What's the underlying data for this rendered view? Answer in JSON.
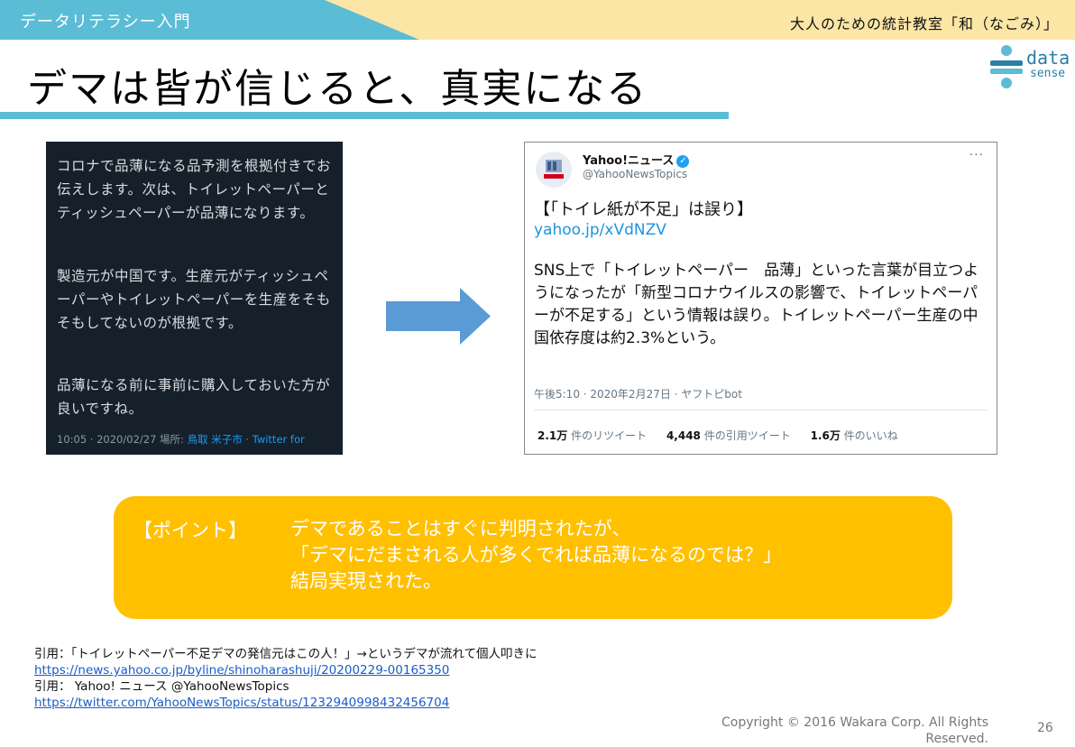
{
  "header": {
    "left_label": "データリテラシー入門",
    "right_label": "大人のための統計教室「和（なごみ）」"
  },
  "title": "デマは皆が信じると、真実になる",
  "logo": {
    "line1": "data",
    "line2": "sense",
    "accent_color": "#2a7fa8"
  },
  "colors": {
    "header_blue": "#5bbcd6",
    "header_yellow": "#fbe6a6",
    "point_box": "#ffc000",
    "arrow": "#5b9bd5"
  },
  "dark_tweet": {
    "paragraphs": [
      "コロナで品薄になる品予測を根拠付きでお伝えします。次は、トイレットペーパーとティッシュペーパーが品薄になります。",
      "製造元が中国です。生産元がティッシュペーパーやトイレットペーパーを生産をそもそもしてないのが根拠です。",
      "品薄になる前に事前に購入しておいた方が良いですね。"
    ],
    "meta_time": "10:05 · 2020/02/27 場所:",
    "meta_location": "鳥取 米子市",
    "meta_source": " · Twitter for"
  },
  "yahoo_tweet": {
    "name": "Yahoo!ニュース",
    "handle": "@YahooNewsTopics",
    "more": "···",
    "heading": "【「トイレ紙が不足」は誤り】",
    "link": "yahoo.jp/xVdNZV",
    "body": "SNS上で「トイレットペーパー　品薄」といった言葉が目立つようになったが「新型コロナウイルスの影響で、トイレットペーパーが不足する」という情報は誤り。トイレットペーパー生産の中国依存度は約2.3%という。",
    "timestamp": "午後5:10 · 2020年2月27日 · ヤフトピbot",
    "stats": [
      {
        "count": "2.1万",
        "label": "件のリツイート"
      },
      {
        "count": "4,448",
        "label": "件の引用ツイート"
      },
      {
        "count": "1.6万",
        "label": "件のいいね"
      }
    ]
  },
  "point": {
    "label": "【ポイント】",
    "lines": [
      "デマであることはすぐに判明されたが、",
      "「デマにだまされる人が多くでれば品薄になるのでは？」",
      "結局実現された。"
    ]
  },
  "citations": [
    {
      "text": "引用：「トイレットペーパー不足デマの発信元はこの人！」→というデマが流れて個人叩きに",
      "url": "https://news.yahoo.co.jp/byline/shinoharashuji/20200229-00165350"
    },
    {
      "text": "引用： Yahoo! ニュース @YahooNewsTopics",
      "url": "https://twitter.com/YahooNewsTopics/status/1232940998432456704"
    }
  ],
  "footer": {
    "copyright": "Copyright © 2016 Wakara Corp. All Rights Reserved.",
    "page_number": "26"
  }
}
